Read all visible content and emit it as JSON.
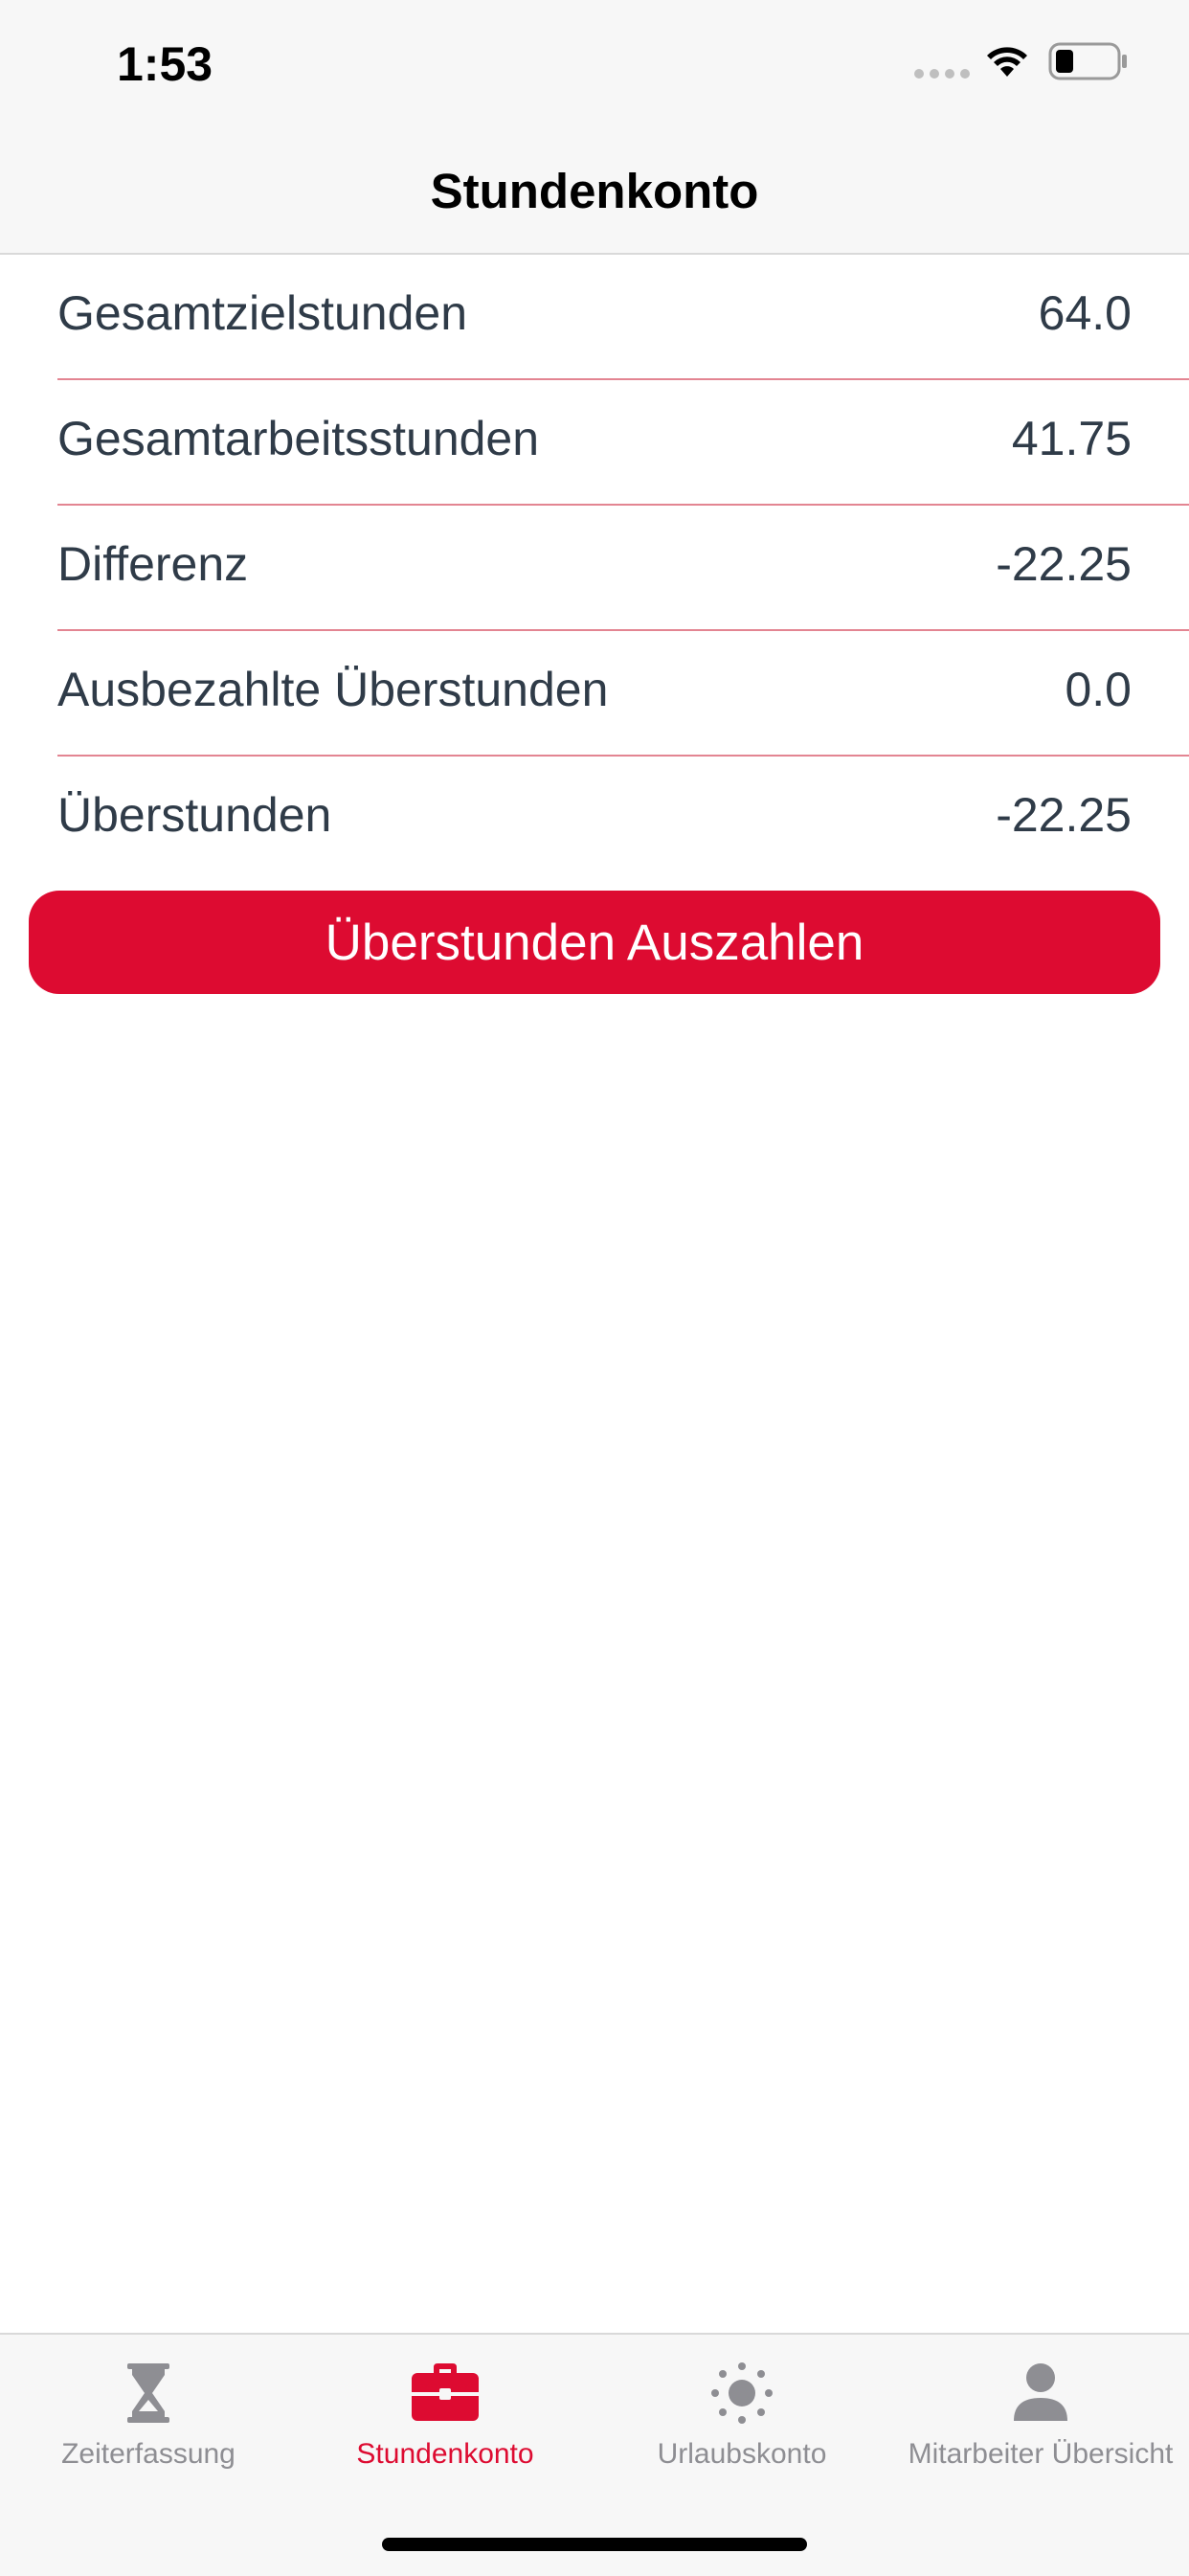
{
  "status_bar": {
    "time": "1:53"
  },
  "nav": {
    "title": "Stundenkonto"
  },
  "rows": [
    {
      "label": "Gesamtzielstunden",
      "value": "64.0"
    },
    {
      "label": "Gesamtarbeitsstunden",
      "value": "41.75"
    },
    {
      "label": "Differenz",
      "value": "-22.25"
    },
    {
      "label": "Ausbezahlte Überstunden",
      "value": "0.0"
    },
    {
      "label": "Überstunden",
      "value": "-22.25"
    }
  ],
  "payout_button": {
    "label": "Überstunden Auszahlen"
  },
  "tabs": [
    {
      "label": "Zeiterfassung",
      "icon": "hourglass-icon",
      "active": false
    },
    {
      "label": "Stundenkonto",
      "icon": "briefcase-icon",
      "active": true
    },
    {
      "label": "Urlaubskonto",
      "icon": "sun-icon",
      "active": false
    },
    {
      "label": "Mitarbeiter Übersicht",
      "icon": "person-icon",
      "active": false
    }
  ],
  "colors": {
    "accent": "#dd0b31",
    "text": "#2f3b48",
    "separator": "#e38592",
    "inactive_tab": "#8e8e93"
  }
}
